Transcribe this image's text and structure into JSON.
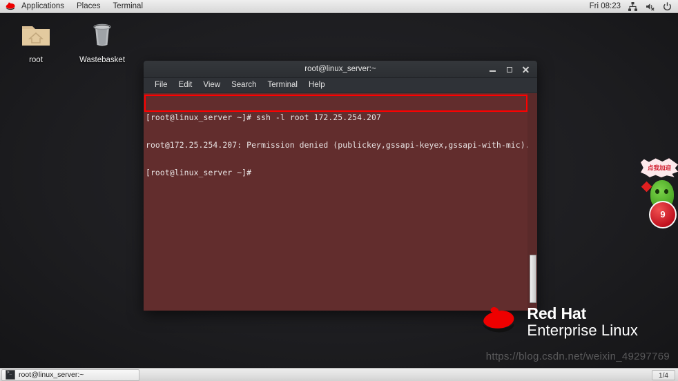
{
  "top_panel": {
    "logo_icon": "redhat-fedora-icon",
    "menus": [
      {
        "label": "Applications",
        "name": "applications-menu"
      },
      {
        "label": "Places",
        "name": "places-menu"
      },
      {
        "label": "Terminal",
        "name": "terminal-menu"
      }
    ],
    "clock": "Fri 08:23",
    "tray_icons": [
      {
        "name": "network-icon",
        "title": "Network"
      },
      {
        "name": "volume-muted-icon",
        "title": "Volume muted"
      },
      {
        "name": "power-icon",
        "title": "Power"
      }
    ]
  },
  "desktop": {
    "icons": [
      {
        "label": "root",
        "icon": "home-folder-icon",
        "name": "desktop-icon-root"
      },
      {
        "label": "Wastebasket",
        "icon": "trash-bin-icon",
        "name": "desktop-icon-wastebasket"
      }
    ]
  },
  "terminal": {
    "title": "root@linux_server:~",
    "window_buttons": {
      "minimize": "minimize-icon",
      "maximize": "maximize-icon",
      "close": "close-icon"
    },
    "menubar": [
      {
        "label": "File"
      },
      {
        "label": "Edit"
      },
      {
        "label": "View"
      },
      {
        "label": "Search"
      },
      {
        "label": "Terminal"
      },
      {
        "label": "Help"
      }
    ],
    "lines": [
      "[root@linux_server ~]# ssh -l root 172.25.254.207",
      "root@172.25.254.207: Permission denied (publickey,gssapi-keyex,gssapi-with-mic).",
      "[root@linux_server ~]#"
    ],
    "background_color": "#622d2d",
    "text_color": "#e9e4e4",
    "highlight_color": "#ff0000",
    "scrollbar": {
      "name": "terminal-scrollbar"
    }
  },
  "branding": {
    "line1": "Red Hat",
    "line2": "Enterprise Linux",
    "logo_icon": "redhat-fedora-logo"
  },
  "watermark": {
    "text": "https://blog.csdn.net/weixin_49297769"
  },
  "float_widget": {
    "bubble_text": "点我加迎",
    "badge_text": "9",
    "mascot_icon": "green-mascot-icon"
  },
  "taskbar": {
    "window_button": {
      "label": "root@linux_server:~",
      "icon": "terminal-icon"
    },
    "workspace": "1/4"
  }
}
